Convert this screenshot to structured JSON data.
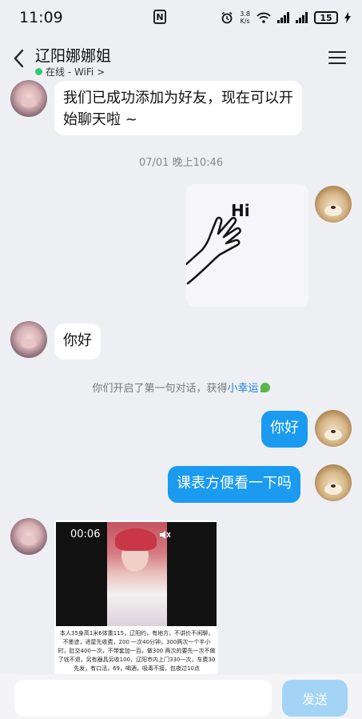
{
  "status_bar": {
    "time": "11:09",
    "net_speed_value": "3.8",
    "net_speed_unit": "K/s",
    "battery": "15"
  },
  "header": {
    "contact_name": "辽阳娜娜姐",
    "presence": "在线 - WiFi >"
  },
  "messages": {
    "greeting": "我们已成功添加为好友，现在可以开始聊天啦 ~",
    "timestamp": "07/01 晚上10:46",
    "sticker_text": "Hi",
    "incoming_hello": "你好",
    "system_note": "你们开启了第一句对话，获得",
    "system_link": "小幸运",
    "outgoing_hello": "你好",
    "outgoing_question": "课表方便看一下吗",
    "video_duration": "00:06",
    "video_caption": "本人35身高1米6体重115，辽阳约，有地方，不讲价不闲聊，不墨迹，进屋先收费，200 一次40分钟，300两次一个半小时，肛交400一次，不带套加一百，做300 两次的要先一次不做了钱不退，另有器具另收100，辽阳市内上门330一次，车费30先发，有口活，69，喝酒，吸毒不接，包夜过10点"
  },
  "input": {
    "placeholder": "",
    "send_label": "发送"
  },
  "colors": {
    "accent": "#1a9bf0",
    "send_disabled": "#a3d4f6",
    "background": "#eeeff3",
    "online": "#2ecc71"
  },
  "icons": [
    "back-icon",
    "menu-icon",
    "nfc-icon",
    "alarm-icon",
    "wifi-icon",
    "signal-icon",
    "battery-icon",
    "mute-icon"
  ]
}
